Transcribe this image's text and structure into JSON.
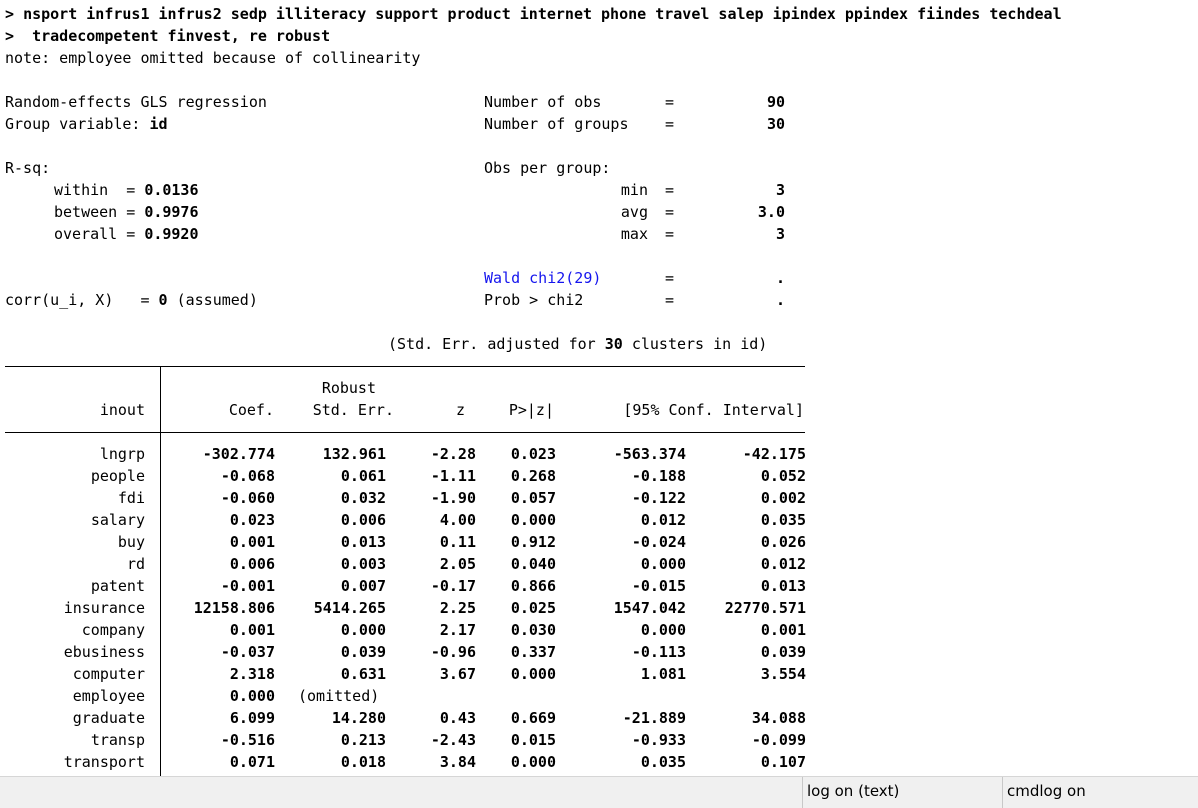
{
  "command": {
    "prompt": ">",
    "line1": "nsport infrus1 infrus2 sedp illiteracy support product internet phone travel salep ipindex ppindex fiindes techdeal",
    "line2": "tradecompetent finvest, re robust"
  },
  "note": "note: employee omitted because of collinearity",
  "header": {
    "model": "Random-effects GLS regression",
    "group_var_label": "Group variable:",
    "group_var": "id",
    "nobs_label": "Number of obs",
    "nobs": "90",
    "ngroups_label": "Number of groups",
    "ngroups": "30",
    "rsq_label": "R-sq:",
    "within_label": "within",
    "within": "0.0136",
    "between_label": "between",
    "between": "0.9976",
    "overall_label": "overall",
    "overall": "0.9920",
    "obs_per_group_label": "Obs per group:",
    "min_label": "min",
    "min": "3",
    "avg_label": "avg",
    "avg": "3.0",
    "max_label": "max",
    "max": "3",
    "wald_label": "Wald chi2(29)",
    "wald": ".",
    "prob_label": "Prob > chi2",
    "prob": ".",
    "corr_label": "corr(u_i, X)",
    "corr_value": "0",
    "corr_note": "(assumed)",
    "eq": "=",
    "se_note_pre": "(Std. Err. adjusted for",
    "se_note_num": "30",
    "se_note_post": "clusters in id)"
  },
  "table": {
    "depvar": "inout",
    "col_robust": "Robust",
    "col_coef": "Coef.",
    "col_se": "Std. Err.",
    "col_z": "z",
    "col_p": "P>|z|",
    "col_ci": "[95% Conf. Interval]",
    "rows": [
      {
        "name": "lngrp",
        "coef": "-302.774",
        "se": "132.961",
        "z": "-2.28",
        "p": "0.023",
        "lo": "-563.374",
        "hi": "-42.175"
      },
      {
        "name": "people",
        "coef": "-0.068",
        "se": "0.061",
        "z": "-1.11",
        "p": "0.268",
        "lo": "-0.188",
        "hi": "0.052"
      },
      {
        "name": "fdi",
        "coef": "-0.060",
        "se": "0.032",
        "z": "-1.90",
        "p": "0.057",
        "lo": "-0.122",
        "hi": "0.002"
      },
      {
        "name": "salary",
        "coef": "0.023",
        "se": "0.006",
        "z": "4.00",
        "p": "0.000",
        "lo": "0.012",
        "hi": "0.035"
      },
      {
        "name": "buy",
        "coef": "0.001",
        "se": "0.013",
        "z": "0.11",
        "p": "0.912",
        "lo": "-0.024",
        "hi": "0.026"
      },
      {
        "name": "rd",
        "coef": "0.006",
        "se": "0.003",
        "z": "2.05",
        "p": "0.040",
        "lo": "0.000",
        "hi": "0.012"
      },
      {
        "name": "patent",
        "coef": "-0.001",
        "se": "0.007",
        "z": "-0.17",
        "p": "0.866",
        "lo": "-0.015",
        "hi": "0.013"
      },
      {
        "name": "insurance",
        "coef": "12158.806",
        "se": "5414.265",
        "z": "2.25",
        "p": "0.025",
        "lo": "1547.042",
        "hi": "22770.571"
      },
      {
        "name": "company",
        "coef": "0.001",
        "se": "0.000",
        "z": "2.17",
        "p": "0.030",
        "lo": "0.000",
        "hi": "0.001"
      },
      {
        "name": "ebusiness",
        "coef": "-0.037",
        "se": "0.039",
        "z": "-0.96",
        "p": "0.337",
        "lo": "-0.113",
        "hi": "0.039"
      },
      {
        "name": "computer",
        "coef": "2.318",
        "se": "0.631",
        "z": "3.67",
        "p": "0.000",
        "lo": "1.081",
        "hi": "3.554"
      },
      {
        "name": "employee",
        "coef": "0.000",
        "se": "(omitted)",
        "z": "",
        "p": "",
        "lo": "",
        "hi": ""
      },
      {
        "name": "graduate",
        "coef": "6.099",
        "se": "14.280",
        "z": "0.43",
        "p": "0.669",
        "lo": "-21.889",
        "hi": "34.088"
      },
      {
        "name": "transp",
        "coef": "-0.516",
        "se": "0.213",
        "z": "-2.43",
        "p": "0.015",
        "lo": "-0.933",
        "hi": "-0.099"
      },
      {
        "name": "transport",
        "coef": "0.071",
        "se": "0.018",
        "z": "3.84",
        "p": "0.000",
        "lo": "0.035",
        "hi": "0.107"
      }
    ]
  },
  "status": {
    "log": "log on (text)",
    "cmdlog": "cmdlog on"
  },
  "icons": {
    "scroll_up": "chevron-up-icon",
    "scroll_down": "chevron-down-icon"
  }
}
